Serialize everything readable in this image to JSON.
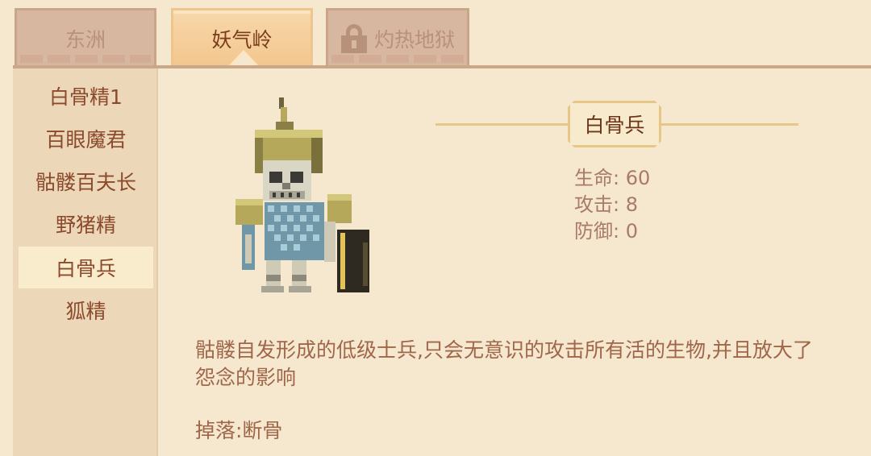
{
  "tabs": [
    {
      "label": "东洲",
      "state": "inactive"
    },
    {
      "label": "妖气岭",
      "state": "active"
    },
    {
      "label": "灼热地狱",
      "state": "locked",
      "icon": "lock-icon"
    }
  ],
  "sidebar": {
    "items": [
      {
        "label": "白骨精1"
      },
      {
        "label": "百眼魔君"
      },
      {
        "label": "骷髅百夫长"
      },
      {
        "label": "野猪精"
      },
      {
        "label": "白骨兵",
        "selected": true
      },
      {
        "label": "狐精"
      }
    ]
  },
  "monster": {
    "name": "白骨兵",
    "portrait_icon": "skeleton-soldier-sprite",
    "stats": [
      {
        "label": "生命:",
        "value": "60"
      },
      {
        "label": "攻击:",
        "value": "8"
      },
      {
        "label": "防御:",
        "value": "0"
      }
    ],
    "description": "骷髅自发形成的低级士兵,只会无意识的攻击所有活的生物,并且放大了怨念的影响",
    "drop": "掉落:断骨"
  },
  "colors": {
    "background": "#f6e8cf",
    "sidebar": "#ecd7b8",
    "active_tab": "#f3c78f",
    "inactive_tab": "#d8b7a0",
    "text_main": "#8b4a2c",
    "accent_gold": "#e6c788"
  }
}
